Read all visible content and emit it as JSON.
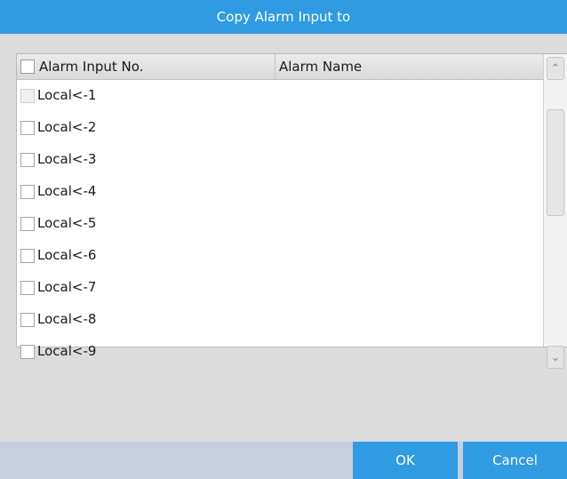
{
  "dialog": {
    "title": "Copy Alarm Input to"
  },
  "table": {
    "headers": [
      "Alarm Input No.",
      "Alarm Name"
    ],
    "rows": [
      {
        "no": "Local<-1",
        "name": "",
        "disabled": true
      },
      {
        "no": "Local<-2",
        "name": "",
        "disabled": false
      },
      {
        "no": "Local<-3",
        "name": "",
        "disabled": false
      },
      {
        "no": "Local<-4",
        "name": "",
        "disabled": false
      },
      {
        "no": "Local<-5",
        "name": "",
        "disabled": false
      },
      {
        "no": "Local<-6",
        "name": "",
        "disabled": false
      },
      {
        "no": "Local<-7",
        "name": "",
        "disabled": false
      },
      {
        "no": "Local<-8",
        "name": "",
        "disabled": false
      },
      {
        "no": "Local<-9",
        "name": "",
        "disabled": false
      }
    ]
  },
  "icons": {
    "scroll_up": "chevron-up-icon",
    "scroll_down": "chevron-down-icon"
  },
  "buttons": {
    "ok": "OK",
    "cancel": "Cancel"
  },
  "colors": {
    "accent": "#2e9be3",
    "background": "#dcdcdc",
    "footer": "#c7cfdc"
  }
}
